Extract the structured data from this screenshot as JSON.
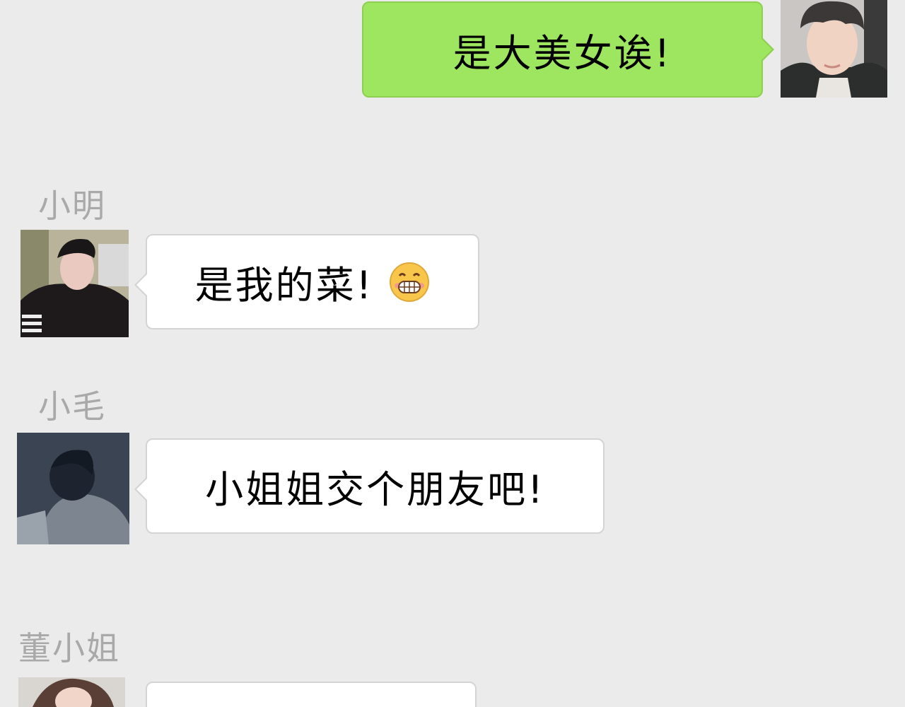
{
  "messages": [
    {
      "direction": "outgoing",
      "text": "是大美女诶!",
      "avatar_icon": "avatar-self-icon"
    },
    {
      "direction": "incoming",
      "sender": "小明",
      "text": "是我的菜!",
      "emoji_icon": "grinning-blush-emoji-icon",
      "avatar_icon": "avatar-xiaoming-icon"
    },
    {
      "direction": "incoming",
      "sender": "小毛",
      "text": "小姐姐交个朋友吧!",
      "avatar_icon": "avatar-xiaomao-icon"
    },
    {
      "direction": "incoming",
      "sender": "董小姐",
      "text": "",
      "avatar_icon": "avatar-dong-icon"
    }
  ],
  "colors": {
    "background": "#ebebeb",
    "outgoing_bubble": "#9fe660",
    "incoming_bubble": "#ffffff",
    "sender_name": "#a9a9a9"
  }
}
